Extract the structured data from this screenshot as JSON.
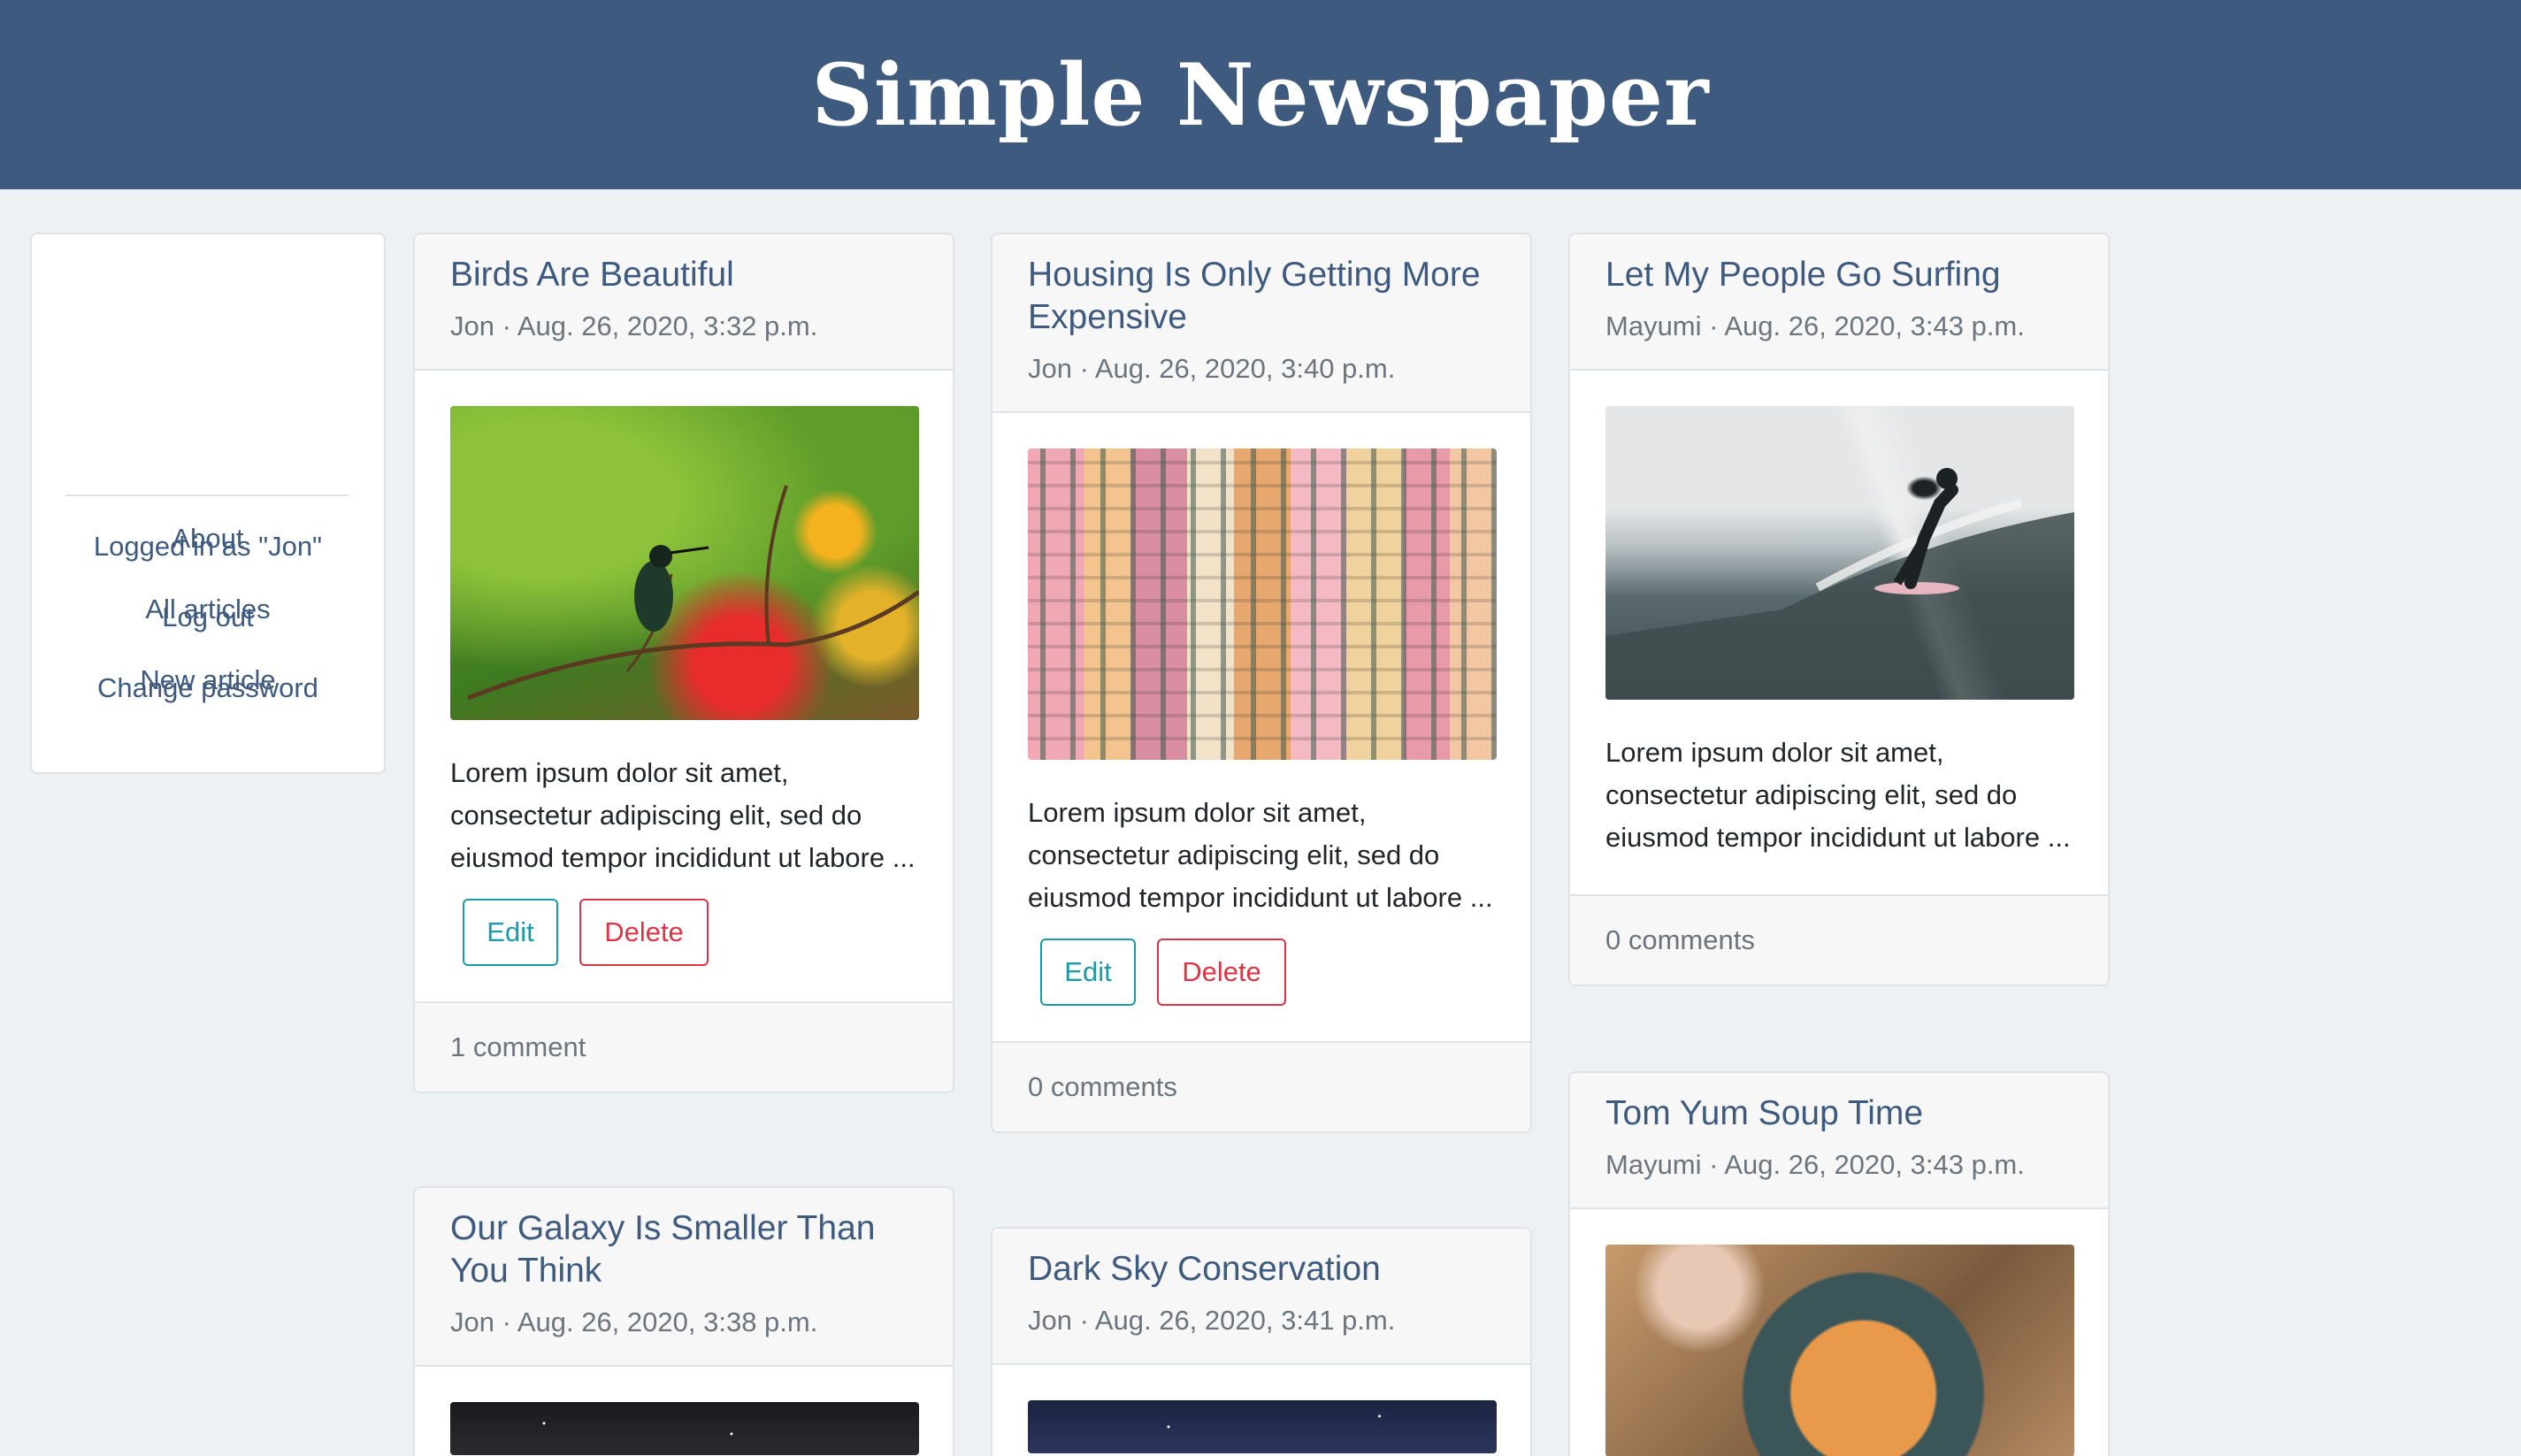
{
  "site": {
    "title": "Simple Newspaper"
  },
  "sidebar": {
    "links": [
      "About",
      "All articles",
      "New article"
    ],
    "user": [
      "Logged in as \"Jon\"",
      "Log out",
      "Change password"
    ]
  },
  "articles": {
    "birds": {
      "title": "Birds Are Beautiful",
      "meta": "Jon · Aug. 26, 2020, 3:32 p.m.",
      "image": "hummingbird-photo",
      "excerpt": "Lorem ipsum dolor sit amet, consectetur adipiscing elit, sed do eiusmod tempor incididunt ut labore ...",
      "edit": "Edit",
      "delete": "Delete",
      "comments": "1 comment"
    },
    "housing": {
      "title": "Housing Is Only Getting More Expensive",
      "meta": "Jon · Aug. 26, 2020, 3:40 p.m.",
      "image": "colorful-houses-photo",
      "excerpt": "Lorem ipsum dolor sit amet, consectetur adipiscing elit, sed do eiusmod tempor incididunt ut labore ...",
      "edit": "Edit",
      "delete": "Delete",
      "comments": "0 comments"
    },
    "surfing": {
      "title": "Let My People Go Surfing",
      "meta": "Mayumi · Aug. 26, 2020, 3:43 p.m.",
      "image": "surfer-photo",
      "excerpt": "Lorem ipsum dolor sit amet, consectetur adipiscing elit, sed do eiusmod tempor incididunt ut labore ...",
      "comments": "0 comments"
    },
    "galaxy": {
      "title": "Our Galaxy Is Smaller Than You Think",
      "meta": "Jon · Aug. 26, 2020, 3:38 p.m.",
      "image": "night-sky-photo"
    },
    "darksky": {
      "title": "Dark Sky Conservation",
      "meta": "Jon · Aug. 26, 2020, 3:41 p.m.",
      "image": "starry-sky-photo"
    },
    "soup": {
      "title": "Tom Yum Soup Time",
      "meta": "Mayumi · Aug. 26, 2020, 3:43 p.m.",
      "image": "soup-bowl-photo"
    }
  },
  "colors": {
    "header": "#3e5a7f",
    "link": "#3e5a7f",
    "edit": "#1a9aa7",
    "delete": "#dc3545"
  }
}
